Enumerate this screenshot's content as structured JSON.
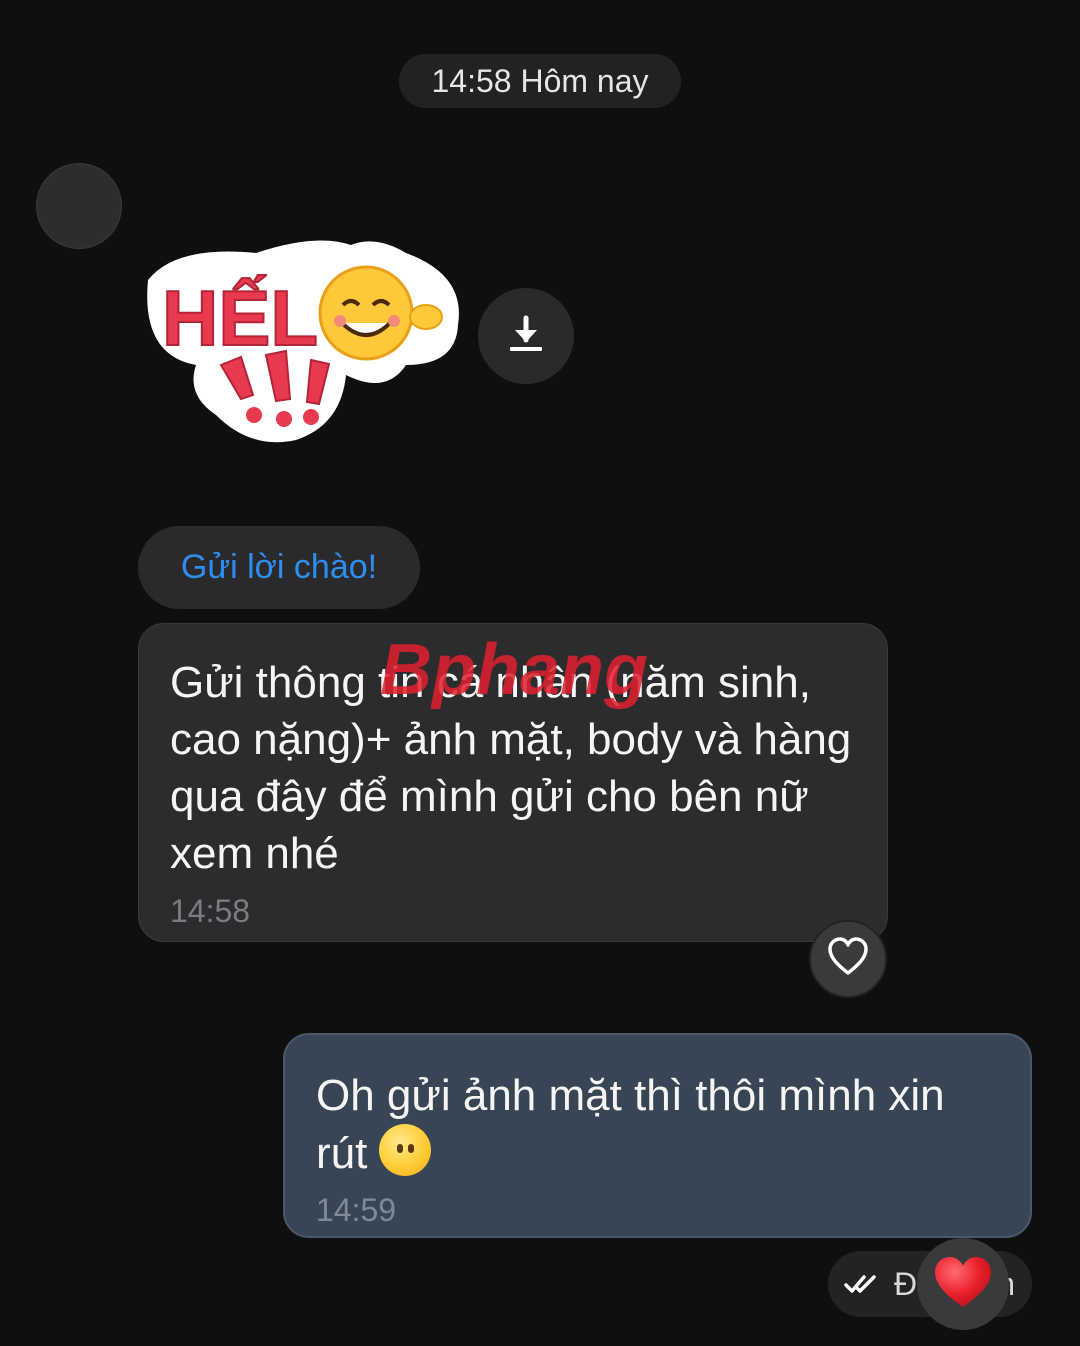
{
  "header": {
    "time_label": "14:58 Hôm nay"
  },
  "sticker": {
    "text": "HẾLÔ"
  },
  "greeting": {
    "button_label": "Gửi lời chào!"
  },
  "incoming_message": {
    "text": "Gửi thông tin cá nhân (năm sinh, cao nặng)+ ảnh mặt, body và hàng qua đây để mình gửi cho bên nữ xem nhé",
    "time": "14:58"
  },
  "watermark": {
    "text": "Bphang"
  },
  "outgoing_message": {
    "text": "Oh gửi ảnh mặt thì thôi mình xin rút",
    "emoji": "neutral-face-emoji",
    "time": "14:59"
  },
  "status": {
    "label": "Đã nhận"
  },
  "icons": {
    "download": "download-icon",
    "like": "heart-outline-icon",
    "reaction": "red-heart-icon",
    "seen": "double-check-icon"
  },
  "colors": {
    "background": "#0f0f10",
    "incoming_bubble": "#2c2c2e",
    "outgoing_bubble": "#384554",
    "accent_blue": "#2e8ef0",
    "reaction_red": "#e8202a"
  }
}
